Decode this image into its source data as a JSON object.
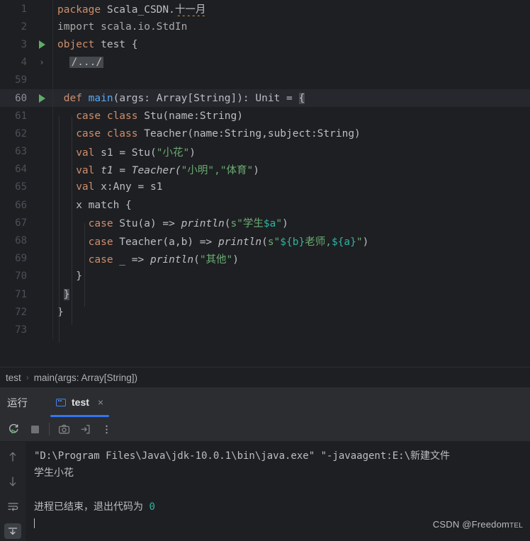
{
  "editor": {
    "lines": [
      {
        "num": "1",
        "marker": "none",
        "fold": false,
        "indent": 0
      },
      {
        "num": "2",
        "marker": "none",
        "fold": false,
        "indent": 0
      },
      {
        "num": "3",
        "marker": "run",
        "fold": false,
        "indent": 0
      },
      {
        "num": "4",
        "marker": "fold",
        "fold": true,
        "indent": 0
      },
      {
        "num": "59",
        "marker": "none",
        "fold": false,
        "indent": 0
      },
      {
        "num": "60",
        "marker": "run",
        "fold": false,
        "indent": 0,
        "current": true
      },
      {
        "num": "61",
        "marker": "none",
        "fold": false,
        "indent": 0
      },
      {
        "num": "62",
        "marker": "none",
        "fold": false,
        "indent": 0
      },
      {
        "num": "63",
        "marker": "none",
        "fold": false,
        "indent": 0
      },
      {
        "num": "64",
        "marker": "none",
        "fold": false,
        "indent": 0
      },
      {
        "num": "65",
        "marker": "none",
        "fold": false,
        "indent": 0
      },
      {
        "num": "66",
        "marker": "none",
        "fold": false,
        "indent": 0
      },
      {
        "num": "67",
        "marker": "none",
        "fold": false,
        "indent": 0
      },
      {
        "num": "68",
        "marker": "none",
        "fold": false,
        "indent": 0
      },
      {
        "num": "69",
        "marker": "none",
        "fold": false,
        "indent": 0
      },
      {
        "num": "70",
        "marker": "none",
        "fold": false,
        "indent": 0
      },
      {
        "num": "71",
        "marker": "none",
        "fold": false,
        "indent": 0
      },
      {
        "num": "72",
        "marker": "none",
        "fold": false,
        "indent": 0
      },
      {
        "num": "73",
        "marker": "none",
        "fold": false,
        "indent": 0
      }
    ],
    "line_numbers": {
      "n1": "1",
      "n2": "2",
      "n3": "3",
      "n4": "4",
      "n59": "59",
      "n60": "60",
      "n61": "61",
      "n62": "62",
      "n63": "63",
      "n64": "64",
      "n65": "65",
      "n66": "66",
      "n67": "67",
      "n68": "68",
      "n69": "69",
      "n70": "70",
      "n71": "71",
      "n72": "72",
      "n73": "73"
    },
    "code": {
      "l1_kw": "package",
      "l1_pkg": " Scala_CSDN.",
      "l1_typo": "十一月",
      "l2": "import scala.io.StdIn",
      "l3_kw": "object",
      "l3_name": " test ",
      "l3_brace": "{",
      "l4_fold": "/.../",
      "l60_kw": "def",
      "l60_fn": " main",
      "l60_sig": "(args: Array[String]): Unit = ",
      "l60_brace": "{",
      "l61_kw": "case class",
      "l61_rest": " Stu(name:String)",
      "l62_kw": "case class",
      "l62_rest": " Teacher(name:String,subject:String)",
      "l63_kw": "val",
      "l63_mid": " s1 = Stu(",
      "l63_str": "\"小花\"",
      "l63_end": ")",
      "l64_kw": "val",
      "l64_mid": " t1 = Teacher(",
      "l64_str": "\"小明\",\"体育\"",
      "l64_end": ")",
      "l65_kw": "val",
      "l65_rest": " x:Any = s1",
      "l66": "x match {",
      "l67_kw": "case",
      "l67_pat": " Stu(a) => ",
      "l67_fn": "println",
      "l67_p1": "(",
      "l67_s1": "s\"学生",
      "l67_i1": "$a",
      "l67_s2": "\"",
      "l67_p2": ")",
      "l68_kw": "case",
      "l68_pat": " Teacher(a,b) => ",
      "l68_fn": "println",
      "l68_p1": "(",
      "l68_s1": "s\"",
      "l68_i1": "${b}",
      "l68_s2": "老师,",
      "l68_i2": "${a}",
      "l68_s3": "\"",
      "l68_p2": ")",
      "l69_kw": "case",
      "l69_pat": " _ => ",
      "l69_fn": "println",
      "l69_p1": "(",
      "l69_s1": "\"其他\"",
      "l69_p2": ")",
      "l70": "}",
      "l71": "}",
      "l72": "}",
      "l73": ""
    }
  },
  "breadcrumb": {
    "crumb1": "test",
    "separator": "›",
    "crumb2": "main(args: Array[String])"
  },
  "run_window": {
    "title": "运行",
    "tab_label": "test",
    "close_label": "×",
    "toolbar": {
      "rerun": "rerun-icon",
      "stop": "stop-icon",
      "screenshot": "camera-icon",
      "export": "export-icon",
      "more": "more-options-icon"
    },
    "side_toolbar": {
      "up": "scroll-up-icon",
      "down": "scroll-down-icon",
      "wrap": "soft-wrap-icon",
      "scroll_end": "scroll-to-end-icon"
    },
    "console": {
      "line1": "\"D:\\Program Files\\Java\\jdk-10.0.1\\bin\\java.exe\" \"-javaagent:E:\\新建文件",
      "line2": "学生小花",
      "line3": "",
      "line4_text": "进程已结束，退出代码为 ",
      "line4_code": "0"
    }
  },
  "watermark": {
    "prefix": "CSDN @Freedom",
    "suffix": "TEL"
  },
  "colors": {
    "background": "#1E1F22",
    "current_line": "#26282E",
    "keyword": "#CF8E6D",
    "string": "#6AAB73",
    "function": "#56A8F5",
    "interpolation": "#2DB4A4",
    "text": "#BCBEC4",
    "accent": "#3574F0",
    "run_green": "#5FAD65"
  }
}
